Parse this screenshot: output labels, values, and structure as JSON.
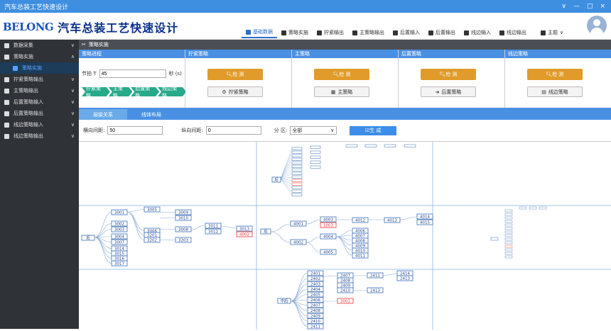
{
  "window": {
    "title": "汽车总装工艺快速设计",
    "controls": [
      "∨",
      "—",
      "□",
      "×"
    ]
  },
  "header": {
    "brand": "BELONG",
    "app_title": "汽车总装工艺快速设计",
    "nav": [
      {
        "label": "基础数据",
        "active": true,
        "icon": "database-icon"
      },
      {
        "label": "策略实施",
        "icon": "tools-icon"
      },
      {
        "label": "拧紧输出",
        "icon": "wrench-icon"
      },
      {
        "label": "主策略输出",
        "icon": "home-icon"
      },
      {
        "label": "后置输入",
        "icon": "login-icon"
      },
      {
        "label": "后置输出",
        "icon": "logout-icon"
      },
      {
        "label": "线边输入",
        "icon": "id-card-icon"
      },
      {
        "label": "线边输出",
        "icon": "id-card-icon"
      },
      {
        "label": "主题",
        "icon": "image-icon",
        "dropdown": true
      }
    ]
  },
  "sidebar": {
    "items": [
      {
        "label": "数据采集",
        "icon": "database-icon",
        "chevron": "∨"
      },
      {
        "label": "策略实施",
        "icon": "tools-icon",
        "chevron": "∧"
      },
      {
        "label": "策略实施",
        "icon": "tools-icon",
        "sub": true,
        "active": true
      },
      {
        "label": "拧紧策略输出",
        "icon": "wrench-icon",
        "chevron": "∨"
      },
      {
        "label": "主策略输出",
        "icon": "home-icon",
        "chevron": "∨"
      },
      {
        "label": "后置策略输入",
        "icon": "login-icon",
        "chevron": "∨"
      },
      {
        "label": "后置策略输出",
        "icon": "logout-icon",
        "chevron": "∨"
      },
      {
        "label": "线边策略输入",
        "icon": "id-card-icon",
        "chevron": "∨"
      },
      {
        "label": "线边策略输出",
        "icon": "id-card-icon",
        "chevron": "∨"
      }
    ]
  },
  "tab": {
    "label": "策略实施"
  },
  "panels": {
    "progress": {
      "title": "策略进程",
      "beat_label": "节拍 T",
      "beat_value": "45",
      "beat_unit": "秒 (s)",
      "steps": [
        "拧紧策略",
        "主策略",
        "后置策略",
        "线边策略"
      ]
    },
    "tighten": {
      "title": "拧紧策略",
      "detect": "检 测",
      "sub": "拧紧策略"
    },
    "main": {
      "title": "主策略",
      "detect": "检 测",
      "sub": "主策略"
    },
    "post": {
      "title": "后置策略",
      "detect": "检 测",
      "sub": "后置策略"
    },
    "line": {
      "title": "线边策略",
      "detect": "检 测",
      "sub": "线边策略"
    }
  },
  "views": {
    "tabs": [
      "层级关系",
      "线体布局"
    ]
  },
  "params": {
    "h_label": "横向间距:",
    "h_value": "50",
    "v_label": "纵向间距:",
    "v_value": "0",
    "zone_label": "分 区:",
    "zone_value": "全部",
    "generate": "生 成"
  },
  "diagram": {
    "root_mid": "后",
    "root_bottom": "中后",
    "nodes_mid_left": [
      "3001",
      "3002",
      "3003",
      "3004",
      "3007",
      "3014",
      "3015",
      "3016",
      "3017",
      "3005",
      "3006",
      "3201",
      "3202",
      "3009",
      "3010",
      "3008",
      "3203",
      "3011",
      "3012",
      "3013",
      "4002"
    ],
    "nodes_mid_right": [
      "4001",
      "4003",
      "1003",
      "4002",
      "4004",
      "4005",
      "4006",
      "4007",
      "4008",
      "4009",
      "4010",
      "4011",
      "4012",
      "4013",
      "4014",
      "4015"
    ],
    "nodes_bottom": [
      "2401",
      "2402",
      "2403",
      "2404",
      "2405",
      "2406",
      "2407",
      "2408",
      "2409",
      "2410",
      "2411",
      "2412",
      "2413",
      "2414",
      "3001"
    ]
  }
}
